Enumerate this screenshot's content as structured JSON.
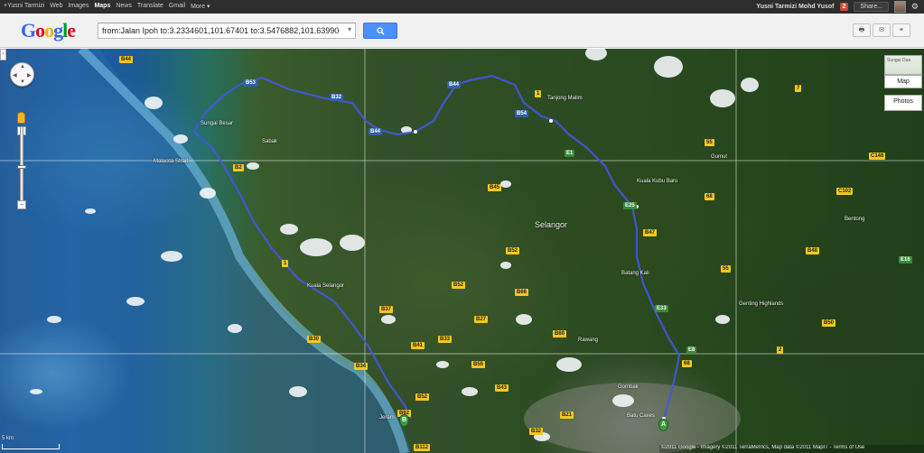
{
  "gbar": {
    "links": [
      "+Yusni Tarmizi",
      "Web",
      "Images",
      "Maps",
      "News",
      "Translate",
      "Gmail",
      "More ▾"
    ],
    "active": "Maps",
    "user_name": "Yusni Tarmizi Mohd Yusof",
    "notifications": "2",
    "share_label": "Share..."
  },
  "header": {
    "logo_text": "Google",
    "search_value": "from:Jalan Ipoh to:3.2334601,101.67401 to:3.5476882,101.63990",
    "search_icon": "search-icon"
  },
  "map_controls": {
    "map_type_label": "Map",
    "photos_label": "Photos",
    "thumb_text": "Sungai Dua",
    "scale_label": "5 km",
    "attribution": "©2011 Google - Imagery ©2011 TerraMetrics, Map data ©2011 MapIT - Terms of Use"
  },
  "markers": {
    "start": "A",
    "end": "B"
  },
  "places": {
    "selangor": "Selangor",
    "batu_caves": "Batu Caves",
    "gombak": "Gombak",
    "bentong": "Bentong",
    "kuala_kubu_baharu": "Kuala Kubu Bharu",
    "tanjung_malim": "Tanjong Malim",
    "sungai_besar": "Sungai Besar",
    "sabak": "Sabak",
    "kuala_selangor": "Kuala Selangor",
    "batang_kali": "Batang Kali",
    "rawang": "Rawang",
    "jeram": "Jeram",
    "gumut": "Gumut",
    "kuala_kubu": "Kuala Kubu Baru",
    "genting": "Genting Highlands",
    "malacca_strait": "Malacca Strait"
  },
  "road_labels": [
    "B44",
    "B53",
    "B32",
    "B44",
    "B44",
    "1",
    "E1",
    "55",
    "68",
    "B54",
    "B2",
    "E25",
    "B52",
    "B33",
    "B37",
    "B27",
    "E33",
    "B41",
    "B48",
    "68",
    "C102",
    "B55",
    "E8",
    "2",
    "B66",
    "B52",
    "C148",
    "B43",
    "B60",
    "B45",
    "B47",
    "E16",
    "B112",
    "B21",
    "B30",
    "B34",
    "7",
    "55",
    "B50",
    "B32",
    "1",
    "B52",
    "B62"
  ]
}
